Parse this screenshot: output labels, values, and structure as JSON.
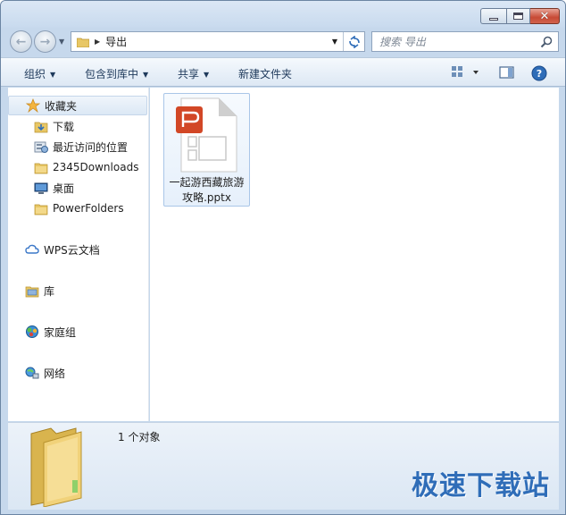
{
  "window": {
    "controls": {
      "minimize": "minimize",
      "maximize": "maximize",
      "close": "✕"
    }
  },
  "address": {
    "path": "导出",
    "search_placeholder": "搜索 导出"
  },
  "toolbar": {
    "organize": "组织",
    "include_in_library": "包含到库中",
    "share": "共享",
    "new_folder": "新建文件夹"
  },
  "sidebar": {
    "favorites": {
      "label": "收藏夹",
      "items": [
        {
          "label": "下载",
          "icon": "download-folder-icon"
        },
        {
          "label": "最近访问的位置",
          "icon": "recent-places-icon"
        },
        {
          "label": "2345Downloads",
          "icon": "folder-icon"
        },
        {
          "label": "桌面",
          "icon": "desktop-icon"
        },
        {
          "label": "PowerFolders",
          "icon": "folder-icon"
        }
      ]
    },
    "wps_cloud": "WPS云文档",
    "libraries": "库",
    "homegroup": "家庭组",
    "network": "网络"
  },
  "files": [
    {
      "name": "一起游西藏旅游攻略.pptx",
      "icon": "pptx-file-icon",
      "selected": true
    }
  ],
  "details": {
    "count": "1 个对象"
  },
  "watermark": "极速下载站",
  "colors": {
    "accent": "#2f6db8",
    "pptx": "#d24726"
  }
}
